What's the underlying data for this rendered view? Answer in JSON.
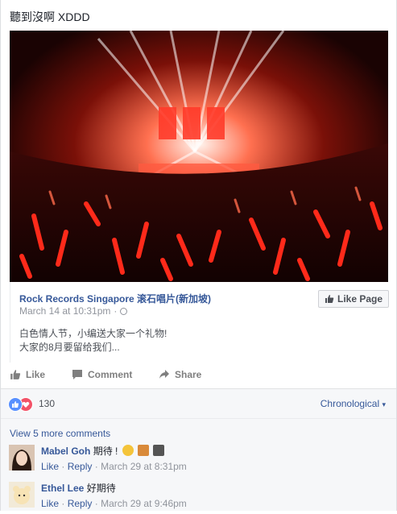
{
  "post": {
    "text": "聽到沒啊 XDDD"
  },
  "share": {
    "source_name": "Rock Records Singapore 滚石唱片(新加坡)",
    "time": "March 14 at 10:31pm",
    "separator": "·",
    "like_page_label": "Like Page",
    "desc_line1": "白色情人节，小编送大家一个礼物!",
    "desc_line2": "大家的8月要留给我们..."
  },
  "actions": {
    "like": "Like",
    "comment": "Comment",
    "share": "Share"
  },
  "reactions": {
    "count": "130",
    "sort_label": "Chronological",
    "sort_caret": "▾"
  },
  "comments": {
    "view_more": "View 5 more comments",
    "items": [
      {
        "name": "Mabel Goh",
        "text": "期待 !",
        "like": "Like",
        "reply": "Reply",
        "dot": "·",
        "time": "March 29 at 8:31pm"
      },
      {
        "name": "Ethel Lee",
        "text": "好期待",
        "like": "Like",
        "reply": "Reply",
        "dot": "·",
        "time": "March 29 at 9:46pm"
      }
    ]
  },
  "colors": {
    "link_blue": "#365899",
    "like_blue": "#5890ff",
    "love_red": "#f25268",
    "stage_red": "#e0241a"
  }
}
